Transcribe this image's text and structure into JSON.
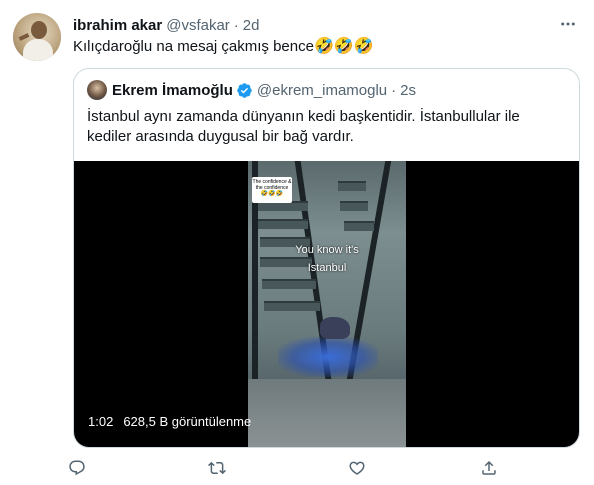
{
  "tweet": {
    "author_name": "ibrahim akar",
    "handle": "@vsfakar",
    "separator": "·",
    "time": "2d",
    "text": "Kılıçdaroğlu na mesaj çakmış bence",
    "emojis": [
      "🤣",
      "🤣",
      "🤣"
    ]
  },
  "quoted_tweet": {
    "author_name": "Ekrem İmamoğlu",
    "verified": true,
    "handle": "@ekrem_imamoglu",
    "separator": "·",
    "time": "2s",
    "text": "İstanbul aynı zamanda dünyanın kedi başkentidir. İstanbullular ile kediler arasında duygusal bir bağ vardır.",
    "video": {
      "sticker_line1": "The confidence &",
      "sticker_line2": "the confidence",
      "sticker_emojis": "🤣🤣🤣",
      "overlay_line1": "You know it's",
      "overlay_line2": "Istanbul",
      "duration": "1:02",
      "views": "628,5 B görüntülenme"
    }
  },
  "actions": {
    "icons": [
      "reply-icon",
      "retweet-icon",
      "like-icon",
      "share-icon"
    ]
  },
  "colors": {
    "text_primary": "#0f1419",
    "text_secondary": "#536471",
    "border": "#cfd9de",
    "verified_blue": "#1d9bf0"
  }
}
